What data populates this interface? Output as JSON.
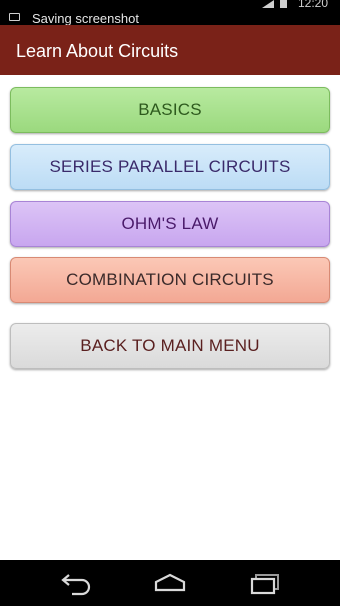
{
  "status_bar": {
    "notification_text": "Saving screenshot",
    "clock": "12:20",
    "icons": [
      "screenshot-notification-icon",
      "signal-icon",
      "battery-icon"
    ]
  },
  "action_bar": {
    "title": "Learn About Circuits",
    "color": "#7a2218"
  },
  "menu": {
    "buttons": [
      {
        "label": "BASICS",
        "color": "#a8e28c"
      },
      {
        "label": "SERIES PARALLEL CIRCUITS",
        "color": "#c8e2f8"
      },
      {
        "label": "OHM'S LAW",
        "color": "#d2b6f2"
      },
      {
        "label": "COMBINATION CIRCUITS",
        "color": "#f7b8a4"
      },
      {
        "label": "BACK TO MAIN MENU",
        "color": "#e2e2e2"
      }
    ]
  },
  "nav_bar": {
    "icons": [
      "back-icon",
      "home-icon",
      "recent-apps-icon"
    ]
  }
}
